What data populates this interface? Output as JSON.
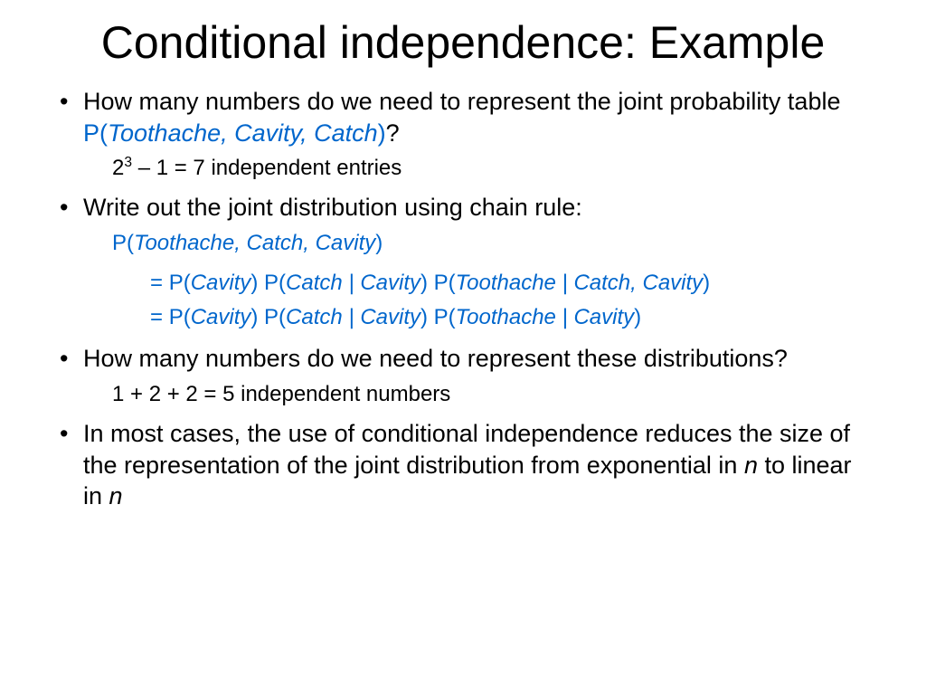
{
  "title": "Conditional independence: Example",
  "b1": {
    "pre": "How many numbers do we need to represent the joint probability table ",
    "p": "P(",
    "vars": "Toothache, Cavity, Catch",
    "close": ")",
    "q": "?"
  },
  "sub1": {
    "a": "2",
    "exp": "3",
    "b": " – 1 = 7 independent entries"
  },
  "b2": "Write out the joint distribution using chain rule:",
  "chain": {
    "lhs_p": "P(",
    "lhs_vars": "Toothache, Catch, Cavity",
    "lhs_close": ")",
    "l1_eq": "= ",
    "l1_p1": "P(",
    "l1_v1": "Cavity",
    "l1_c1": ") ",
    "l1_p2": "P(",
    "l1_v2": "Catch | Cavity",
    "l1_c2": ") ",
    "l1_p3": "P(",
    "l1_v3": "Toothache | Catch, Cavity",
    "l1_c3": ")",
    "l2_eq": "= ",
    "l2_p1": "P(",
    "l2_v1": "Cavity",
    "l2_c1": ") ",
    "l2_p2": "P(",
    "l2_v2": "Catch | Cavity",
    "l2_c2": ") ",
    "l2_p3": "P(",
    "l2_v3": "Toothache | Cavity",
    "l2_c3": ")"
  },
  "b3": "How many numbers do we need to represent these distributions?",
  "sub3": "1 + 2 + 2 = 5 independent numbers",
  "b4": {
    "a": "In most cases, the use of conditional independence reduces the size of the representation of the joint distribution from exponential in ",
    "n1": "n",
    "b": " to linear in ",
    "n2": "n"
  }
}
